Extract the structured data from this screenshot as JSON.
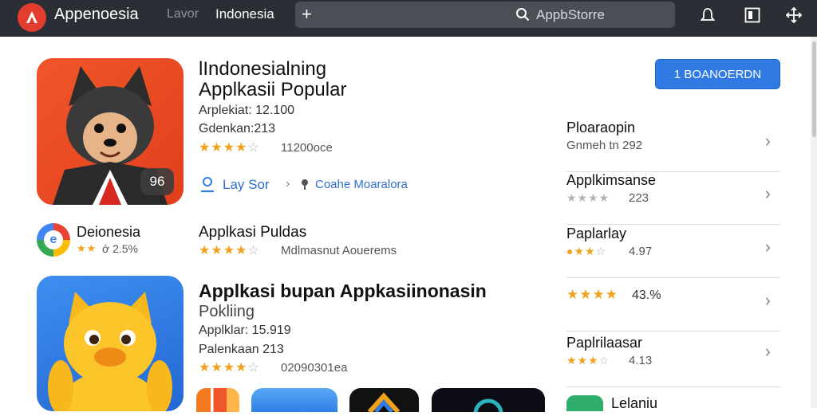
{
  "header": {
    "app_name": "Appenoesia",
    "tabs": [
      "Lavor",
      "Indonesia"
    ],
    "search_plus": "+",
    "search_placeholder": "AppbStorre"
  },
  "featured": {
    "title_line1": "lIndonesialning",
    "title_line2": "Applkasii Popular",
    "line_1": "Arplekiat: 12.100",
    "line_2": "Gdenkan:213",
    "rating_text": "11200oce",
    "rating_stars": 4,
    "badge": "96",
    "link_1": "Lay Sor",
    "link_2": "Coahe Moaralora",
    "install_label": "1 BOANOERDN"
  },
  "row2": {
    "name": "Deionesia",
    "rating": "ớ 2.5%",
    "title": "Applkasi Puldas",
    "subtitle": "Mdlmasnut Aouerems"
  },
  "row3": {
    "title": "Applkasi bupan Appkasiinonasin",
    "subtitle": "Pokliing",
    "line_1": "Applklar: 15.919",
    "line_2": "Palenkaan 213",
    "rating_text": "02090301ea"
  },
  "side": [
    {
      "title": "Ploaraopin",
      "sub": "Gnmeh tn 292"
    },
    {
      "title": "Applkimsanse",
      "sub": "223"
    },
    {
      "title": "Paplarlay",
      "sub": "4.97"
    },
    {
      "title": "",
      "sub": "43.%"
    },
    {
      "title": "Paplrilaasar",
      "sub": "4.13"
    },
    {
      "title": "Lelaniu",
      "sub": ""
    }
  ],
  "colors": {
    "accent": "#2f7be3",
    "topbar": "#2b2f35",
    "star": "#f1a21c"
  }
}
